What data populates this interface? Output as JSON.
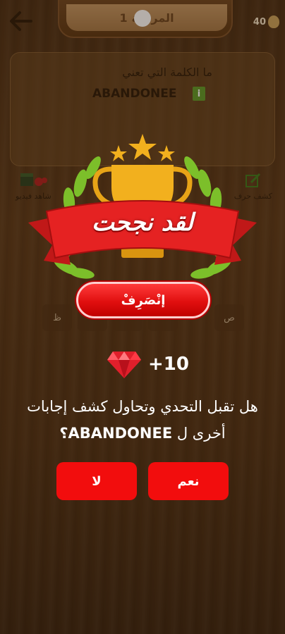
{
  "header": {
    "level_label": "المرحلة",
    "level_number": "1",
    "coins": "40"
  },
  "question": {
    "prompt": "ما الكلمة التي تعني",
    "word": "ABANDONEE",
    "info_symbol": "i"
  },
  "helpers": {
    "left_label": "شاهد فيديو",
    "right_label": "كشف حرف"
  },
  "letter_tiles": [
    "ظ",
    "ص"
  ],
  "popup": {
    "title": "لقد نجحت",
    "leave_label": "إنْصَرِفْ",
    "reward": "+10",
    "challenge_line1": "هل  تقبل التحدي وتحاول كشف إجابات",
    "challenge_line2_prefix": "أخرى ل",
    "challenge_line2_word": "ABANDONEE؟",
    "yes_label": "نعم",
    "no_label": "لا"
  },
  "colors": {
    "accent_red": "#f20d0d",
    "gold": "#f2b01e",
    "leaf_green": "#7cbf2a",
    "wood": "#5a3818"
  }
}
